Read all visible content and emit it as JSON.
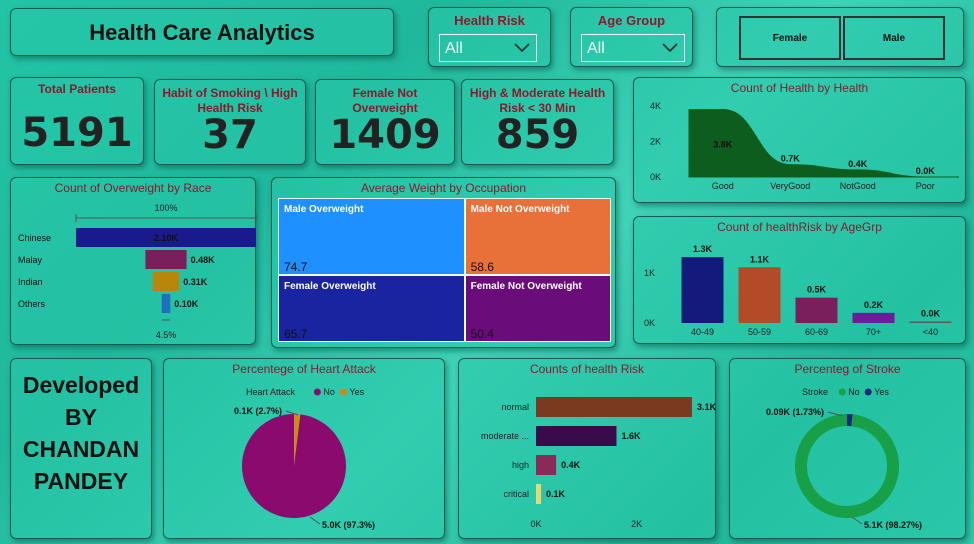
{
  "header": {
    "title": "Health Care Analytics"
  },
  "slicers": {
    "health_risk": {
      "title": "Health Risk",
      "value": "All"
    },
    "age_group": {
      "title": "Age Group",
      "value": "All"
    },
    "gender_buttons": [
      "Female",
      "Male"
    ]
  },
  "kpis": [
    {
      "title": "Total Patients",
      "value": "5191"
    },
    {
      "title": "Habit of Smoking \\ High Health Risk",
      "value": "37"
    },
    {
      "title": "Female Not Overweight",
      "value": "1409"
    },
    {
      "title": "High & Moderate Health Risk < 30 Min",
      "value": "859"
    }
  ],
  "credit": {
    "text": "Developed BY CHANDAN PANDEY"
  },
  "chart_data": [
    {
      "id": "health_by_health",
      "type": "area",
      "title": "Count of Health by Health",
      "categories": [
        "Good",
        "VeryGood",
        "NotGood",
        "Poor"
      ],
      "values": [
        3800,
        700,
        400,
        0
      ],
      "data_labels": [
        "3.8K",
        "0.7K",
        "0.4K",
        "0.0K"
      ],
      "y_ticks": [
        "4K",
        "2K",
        "0K"
      ],
      "ylim": [
        0,
        4000
      ],
      "color": "#0d5e1e"
    },
    {
      "id": "overweight_by_race",
      "type": "bar",
      "title": "Count of Overweight by Race",
      "categories": [
        "Chinese",
        "Malay",
        "Indian",
        "Others"
      ],
      "values": [
        2100,
        480,
        310,
        100
      ],
      "data_labels": [
        "2.10K",
        "0.48K",
        "0.31K",
        "0.10K"
      ],
      "colors": [
        "#1a1a8c",
        "#7a1f5c",
        "#b8860b",
        "#1f6fbf"
      ],
      "top_label": "100%",
      "bottom_label": "4.5%"
    },
    {
      "id": "weight_by_occupation",
      "type": "heatmap",
      "title": "Average Weight by Occupation",
      "cells": [
        {
          "name": "Male Overweight",
          "value": "74.7",
          "color": "#1e90ff"
        },
        {
          "name": "Male Not Overweight",
          "value": "58.6",
          "color": "#e8713a"
        },
        {
          "name": "Female Overweight",
          "value": "65.7",
          "color": "#1a24a0"
        },
        {
          "name": "Female Not Overweight",
          "value": "50.4",
          "color": "#6a0c7a"
        }
      ]
    },
    {
      "id": "healthrisk_by_agegrp",
      "type": "bar",
      "title": "Count of healthRisk by AgeGrp",
      "categories": [
        "40-49",
        "50-59",
        "60-69",
        "70+",
        "<40"
      ],
      "values": [
        1300,
        1100,
        500,
        200,
        0
      ],
      "data_labels": [
        "1.3K",
        "1.1K",
        "0.5K",
        "0.2K",
        "0.0K"
      ],
      "colors": [
        "#141a7a",
        "#b34a28",
        "#7a1f5c",
        "#6a1e9c",
        "#5a5a5a"
      ],
      "y_ticks": [
        "1K",
        "0K"
      ],
      "ylim": [
        0,
        1500
      ]
    },
    {
      "id": "heart_attack",
      "type": "pie",
      "title": "Percentege of Heart Attack",
      "legend_title": "Heart Attack",
      "labels": [
        "No",
        "Yes"
      ],
      "values": [
        5000,
        100
      ],
      "slice_labels": [
        "5.0K (97.3%)",
        "0.1K (2.7%)"
      ],
      "colors": [
        "#8b0a6e",
        "#d18a17"
      ]
    },
    {
      "id": "health_risk_counts",
      "type": "bar",
      "title": "Counts of health Risk",
      "categories": [
        "normal",
        "moderate ...",
        "high",
        "critical"
      ],
      "values": [
        3100,
        1600,
        400,
        100
      ],
      "data_labels": [
        "3.1K",
        "1.6K",
        "0.4K",
        "0.1K"
      ],
      "colors": [
        "#7a3a20",
        "#3a0a4a",
        "#8a2a5a",
        "#e8d870"
      ],
      "x_ticks": [
        "0K",
        "2K"
      ],
      "xlim": [
        0,
        3300
      ]
    },
    {
      "id": "stroke",
      "type": "pie",
      "title": "Percenteg of Stroke",
      "legend_title": "Stroke",
      "labels": [
        "No",
        "Yes"
      ],
      "values": [
        5100,
        90
      ],
      "slice_labels": [
        "5.1K (98.27%)",
        "0.09K (1.73%)"
      ],
      "colors": [
        "#18a048",
        "#1a2a7a"
      ]
    }
  ]
}
